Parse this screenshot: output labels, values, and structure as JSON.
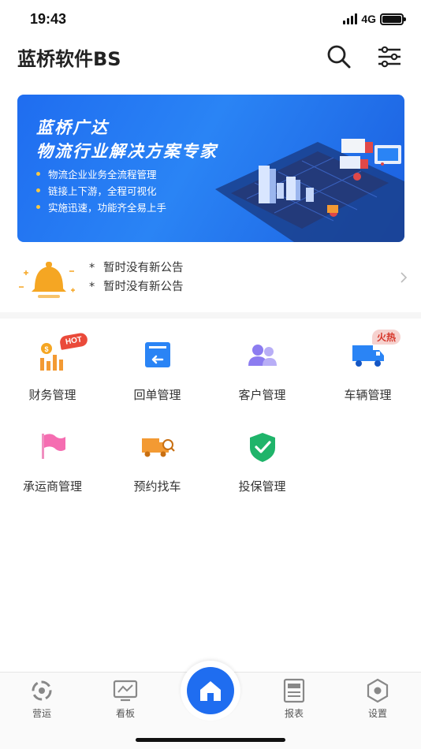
{
  "status_bar": {
    "time": "19:43",
    "network": "4G"
  },
  "header": {
    "title": "蓝桥软件BS"
  },
  "banner": {
    "title_line1": "蓝桥广达",
    "title_line2": "物流行业解决方案专家",
    "points": [
      "物流企业业务全流程管理",
      "链接上下游，全程可视化",
      "实施迅速，功能齐全易上手"
    ]
  },
  "notice": {
    "lines": [
      "暂时没有新公告",
      "暂时没有新公告"
    ],
    "bullet": "*"
  },
  "grid": {
    "items": [
      {
        "label": "财务管理",
        "icon": "finance-chart-icon",
        "badge": "HOT"
      },
      {
        "label": "回单管理",
        "icon": "receipt-return-icon"
      },
      {
        "label": "客户管理",
        "icon": "customers-icon"
      },
      {
        "label": "车辆管理",
        "icon": "truck-icon",
        "badge": "火热"
      },
      {
        "label": "承运商管理",
        "icon": "flag-icon"
      },
      {
        "label": "预约找车",
        "icon": "truck-search-icon"
      },
      {
        "label": "投保管理",
        "icon": "shield-check-icon"
      }
    ]
  },
  "tabbar": {
    "tabs": [
      {
        "label": "营运",
        "icon": "operations-icon"
      },
      {
        "label": "看板",
        "icon": "dashboard-icon"
      },
      {
        "label": "报表",
        "icon": "report-icon"
      },
      {
        "label": "设置",
        "icon": "settings-icon"
      }
    ],
    "home_icon": "home-icon"
  },
  "colors": {
    "primary": "#1f6df0",
    "hot_red": "#ea4a3a",
    "bell_orange": "#f5a623"
  }
}
